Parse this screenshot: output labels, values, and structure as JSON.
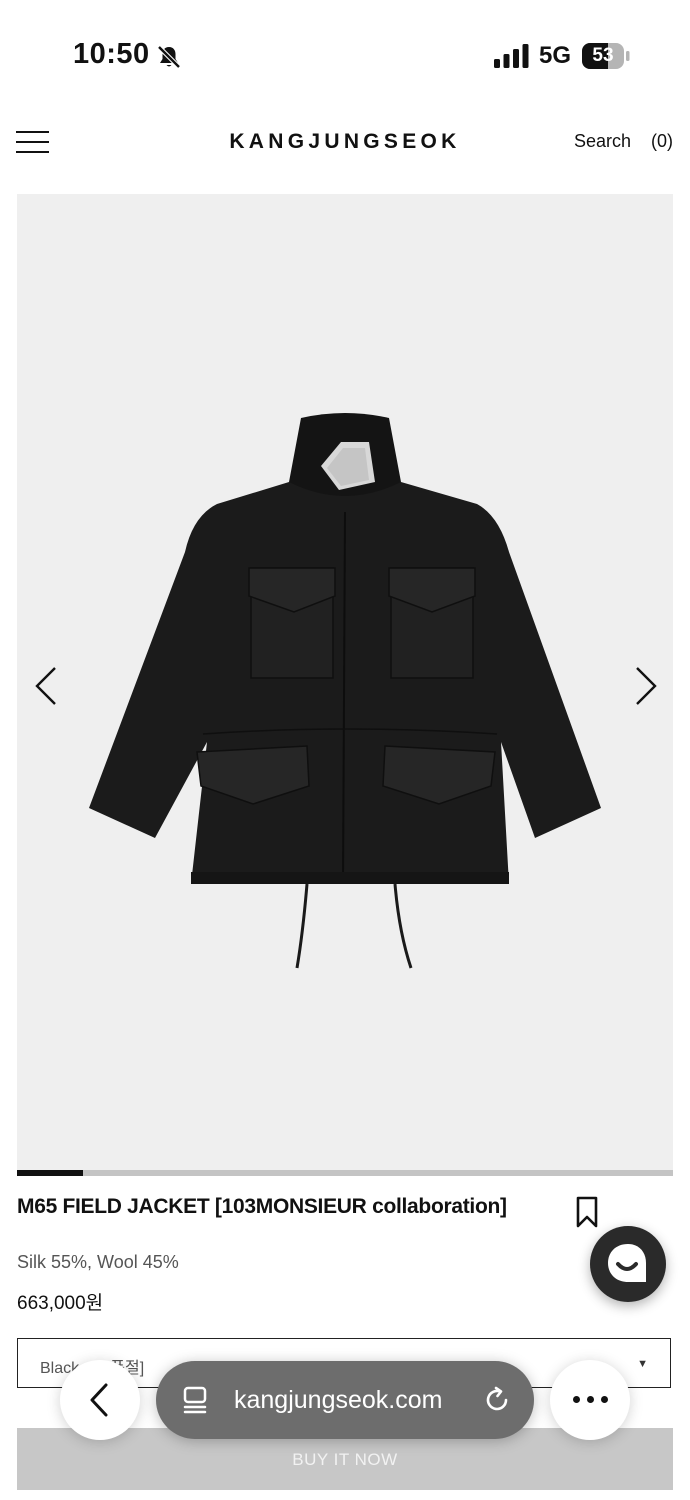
{
  "status_bar": {
    "time": "10:50",
    "network": "5G",
    "battery": "53"
  },
  "header": {
    "logo": "KANGJUNGSEOK",
    "search_label": "Search",
    "cart_label": "(0)"
  },
  "gallery": {
    "current_image": 1,
    "image_count": 8,
    "progress_fraction": 0.1
  },
  "product": {
    "title": "M65 FIELD JACKET [103MONSIEUR collaboration]",
    "material": "Silk 55%, Wool 45%",
    "price": "663,000원"
  },
  "option_select": {
    "value": "Black 46 [품절]"
  },
  "buy_button": {
    "label": "BUY IT NOW"
  },
  "browser": {
    "url": "kangjungseok.com"
  },
  "colors": {
    "buy_disabled": "#c7c7c7",
    "chat_button": "#2a2a2a",
    "url_pill": "#6d6d6d"
  }
}
